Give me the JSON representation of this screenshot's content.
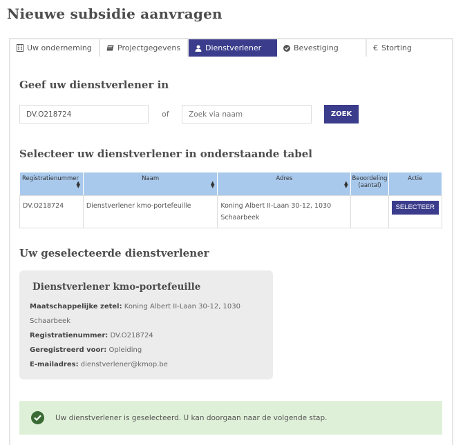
{
  "page": {
    "title": "Nieuwe subsidie aanvragen"
  },
  "tabs": [
    {
      "label": "Uw onderneming",
      "icon": "building-icon",
      "active": false
    },
    {
      "label": "Projectgegevens",
      "icon": "book-icon",
      "active": false
    },
    {
      "label": "Dienstverlener",
      "icon": "user-icon",
      "active": true
    },
    {
      "label": "Bevestiging",
      "icon": "check-circle-icon",
      "active": false
    },
    {
      "label": "Storting",
      "icon": "euro-icon",
      "active": false
    }
  ],
  "search": {
    "heading": "Geef uw dienstverlener in",
    "registration_value": "DV.O218724",
    "or_label": "of",
    "name_placeholder": "Zoek via naam",
    "button_label": "ZOEK"
  },
  "table": {
    "heading": "Selecteer uw dienstverlener in onderstaande tabel",
    "columns": [
      "Registratienummer",
      "Naam",
      "Adres",
      "Beoordeling (aantal)",
      "Actie"
    ],
    "rows": [
      {
        "registratienummer": "DV.O218724",
        "naam": "Dienstverlener kmo-portefeuille",
        "adres": "Koning Albert II-Laan 30-12, 1030 Schaarbeek",
        "beoordeling": "",
        "action_label": "SELECTEER"
      }
    ]
  },
  "selected": {
    "heading": "Uw geselecteerde dienstverlener",
    "name": "Dienstverlener kmo-portefeuille",
    "fields": [
      {
        "label": "Maatschappelijke zetel:",
        "value": "Koning Albert II-Laan 30-12, 1030 Schaarbeek"
      },
      {
        "label": "Registratienummer:",
        "value": "DV.O218724"
      },
      {
        "label": "Geregistreerd voor:",
        "value": "Opleiding"
      },
      {
        "label": "E-mailadres:",
        "value": "dienstverlener@kmop.be"
      }
    ]
  },
  "alert": {
    "message": "Uw dienstverlener is geselecteerd. U kan doorgaan naar de volgende stap.",
    "icon": "check-circle-icon"
  },
  "colors": {
    "primary": "#3b3d8c",
    "table_header": "#a9c9ec",
    "success_bg": "#dff0d8",
    "success_icon": "#3a6b35",
    "card_bg": "#ececec"
  }
}
